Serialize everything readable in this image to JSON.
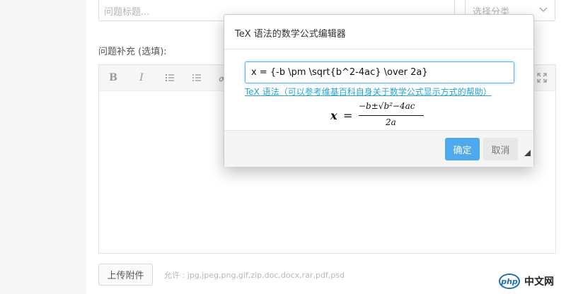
{
  "form": {
    "title_placeholder": "问题标题...",
    "category_placeholder": "选择分类",
    "supplement_label": "问题补充 (选填):",
    "upload_label": "上传附件",
    "allowed_types": "允许 : jpg,jpeg,png,gif,zip,doc,docx,rar,pdf,psd"
  },
  "toolbar": {
    "bold": "B",
    "italic": "I"
  },
  "modal": {
    "title": "TeX 语法的数学公式编辑器",
    "tex_value": "x = {-b \\pm \\sqrt{b^2-4ac} \\over 2a}",
    "help_link": "TeX 语法（可以参考维基百科自身关于数学公式显示方式的帮助）",
    "ok_label": "确定",
    "cancel_label": "取消"
  },
  "preview": {
    "lhs": "x",
    "eq": "=",
    "numerator": "−b±√b²−4ac",
    "denominator": "2a"
  },
  "watermark": {
    "logo_text": "php",
    "site_text": "中文网"
  },
  "colors": {
    "accent": "#4ea9ee",
    "link": "#2aa3d6"
  }
}
